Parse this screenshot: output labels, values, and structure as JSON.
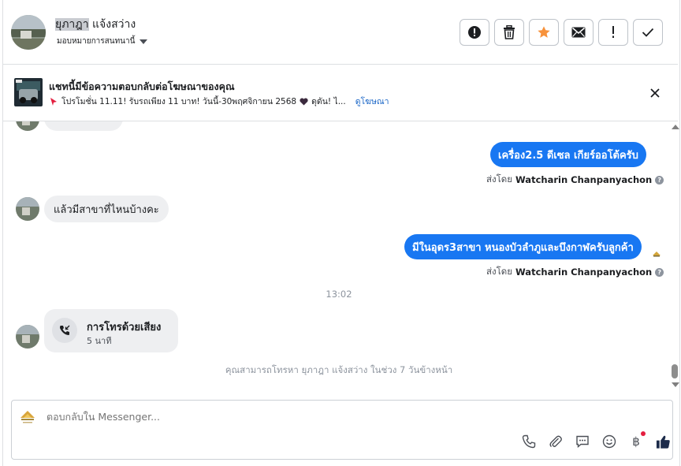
{
  "header": {
    "name_highlight": "ยุภาฎา",
    "name_rest": " แจ้งสว่าง",
    "assign_label": "มอบหมายการสนทนานี้",
    "actions": [
      {
        "name": "report-icon",
        "glyph": "!"
      },
      {
        "name": "trash-icon",
        "glyph": "trash"
      },
      {
        "name": "star-icon",
        "glyph": "star"
      },
      {
        "name": "envelope-icon",
        "glyph": "mail"
      },
      {
        "name": "spam-icon",
        "glyph": "!"
      },
      {
        "name": "check-icon",
        "glyph": "check"
      }
    ]
  },
  "ad_banner": {
    "title": "แชทนี้มีข้อความตอบกลับต่อโฆษณาของคุณ",
    "detail": "โปรโมชั่น 11.11! รับรถเพียง 11 บาท! วันนี้-30พฤศจิกายน 2568",
    "detail_tail": "ดุดัน! ไ...",
    "link": "ดูโฆษณา"
  },
  "thread": {
    "messages": [
      {
        "dir": "out",
        "text": "เครื่อง2.5 ดีเซล เกียร์ออโต้ครับ"
      },
      {
        "dir": "in",
        "text": "แล้วมีสาขาที่ไหนบ้างคะ"
      },
      {
        "dir": "out",
        "text": "มีในอุดร3สาขา หนองบัวลำภูและบึงกาฬครับลูกค้า"
      }
    ],
    "sent_by_prefix": "ส่งโดย",
    "sent_by_name": "Watcharin Chanpanyachon",
    "timestamp": "13:02",
    "call": {
      "title": "การโทรด้วยเสียง",
      "duration": "5 นาที"
    },
    "notice": "คุณสามารถโทรหา ยุภาฎา แจ้งสว่าง ในช่วง 7 วันข้างหน้า"
  },
  "composer": {
    "placeholder": "ตอบกลับใน Messenger..."
  },
  "colors": {
    "accent": "#1877f2",
    "bubble_in": "#eeeff1",
    "star": "#f7923b"
  }
}
